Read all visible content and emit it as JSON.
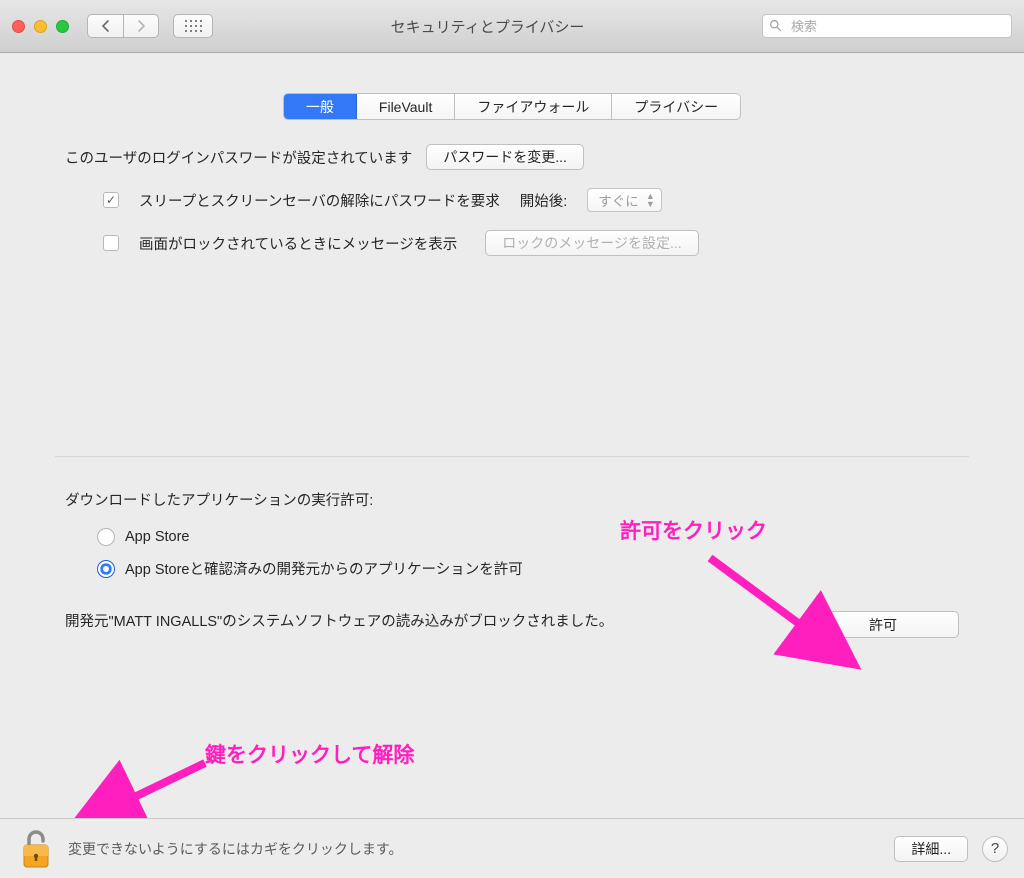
{
  "window": {
    "title": "セキュリティとプライバシー"
  },
  "search": {
    "placeholder": "検索"
  },
  "tabs": {
    "general": "一般",
    "filevault": "FileVault",
    "firewall": "ファイアウォール",
    "privacy": "プライバシー"
  },
  "password_row": {
    "label": "このユーザのログインパスワードが設定されています",
    "button": "パスワードを変更..."
  },
  "sleep_row": {
    "label": "スリープとスクリーンセーバの解除にパスワードを要求",
    "after": "開始後:",
    "select_value": "すぐに"
  },
  "lockmsg_row": {
    "label": "画面がロックされているときにメッセージを表示",
    "button": "ロックのメッセージを設定..."
  },
  "downloads": {
    "title": "ダウンロードしたアプリケーションの実行許可:",
    "option_appstore": "App Store",
    "option_identified": "App Storeと確認済みの開発元からのアプリケーションを許可"
  },
  "blocked": {
    "text": "開発元\"MATT INGALLS\"のシステムソフトウェアの読み込みがブロックされました。",
    "allow": "許可"
  },
  "bottom": {
    "lock_text": "変更できないようにするにはカギをクリックします。",
    "details": "詳細...",
    "help": "?"
  },
  "annotations": {
    "allow_hint": "許可をクリック",
    "lock_hint": "鍵をクリックして解除"
  }
}
